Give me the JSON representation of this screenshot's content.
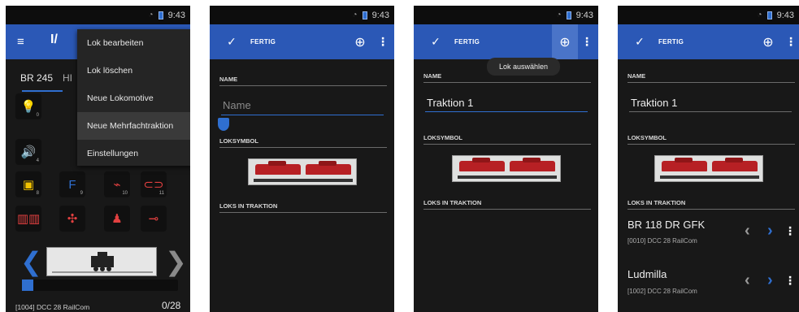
{
  "status": {
    "time": "9:43"
  },
  "screen1": {
    "tabs": [
      "BR 245",
      "HI"
    ],
    "menu": [
      "Lok bearbeiten",
      "Lok löschen",
      "Neue Lokomotive",
      "Neue Mehrfachtraktion",
      "Einstellungen"
    ],
    "functions": [
      {
        "icon": "lightbulb-icon",
        "glyph": "💡",
        "num": "0",
        "color": "#f2c200"
      },
      {
        "icon": "speaker-icon",
        "glyph": "🔊",
        "num": "4",
        "color": "#e24040"
      },
      {
        "icon": "cab-icon",
        "glyph": "▣",
        "num": "8",
        "color": "#f2c200"
      },
      {
        "icon": "f-icon",
        "glyph": "F",
        "num": "9",
        "color": "#2f6fd0"
      },
      {
        "icon": "horn-icon",
        "glyph": "⌁",
        "num": "10",
        "color": "#e24040"
      },
      {
        "icon": "coupling-icon",
        "glyph": "⊂⊃",
        "num": "11",
        "color": "#e24040"
      },
      {
        "icon": "track-icon",
        "glyph": "▥▥",
        "num": "",
        "color": "#e24040"
      },
      {
        "icon": "worker-icon",
        "glyph": "✣",
        "num": "",
        "color": "#e24040"
      },
      {
        "icon": "conductor-icon",
        "glyph": "♟",
        "num": "",
        "color": "#e24040"
      },
      {
        "icon": "whistle-icon",
        "glyph": "⊸",
        "num": "",
        "color": "#e24040"
      }
    ],
    "footer": "[1004]  DCC 28 RailCom",
    "speed": "0/28"
  },
  "edit": {
    "done_label": "FERTIG",
    "name_label": "NAME",
    "name_placeholder": "Name",
    "name_value": "Traktion 1",
    "loksymbol_label": "LOKSYMBOL",
    "loks_label": "LOKS IN TRAKTION",
    "tooltip": "Lok auswählen"
  },
  "screen4": {
    "locos": [
      {
        "name": "BR 118 DR GFK",
        "sub": "[0010]  DCC 28 RailCom"
      },
      {
        "name": "Ludmilla",
        "sub": "[1002]  DCC 28 RailCom"
      }
    ]
  }
}
